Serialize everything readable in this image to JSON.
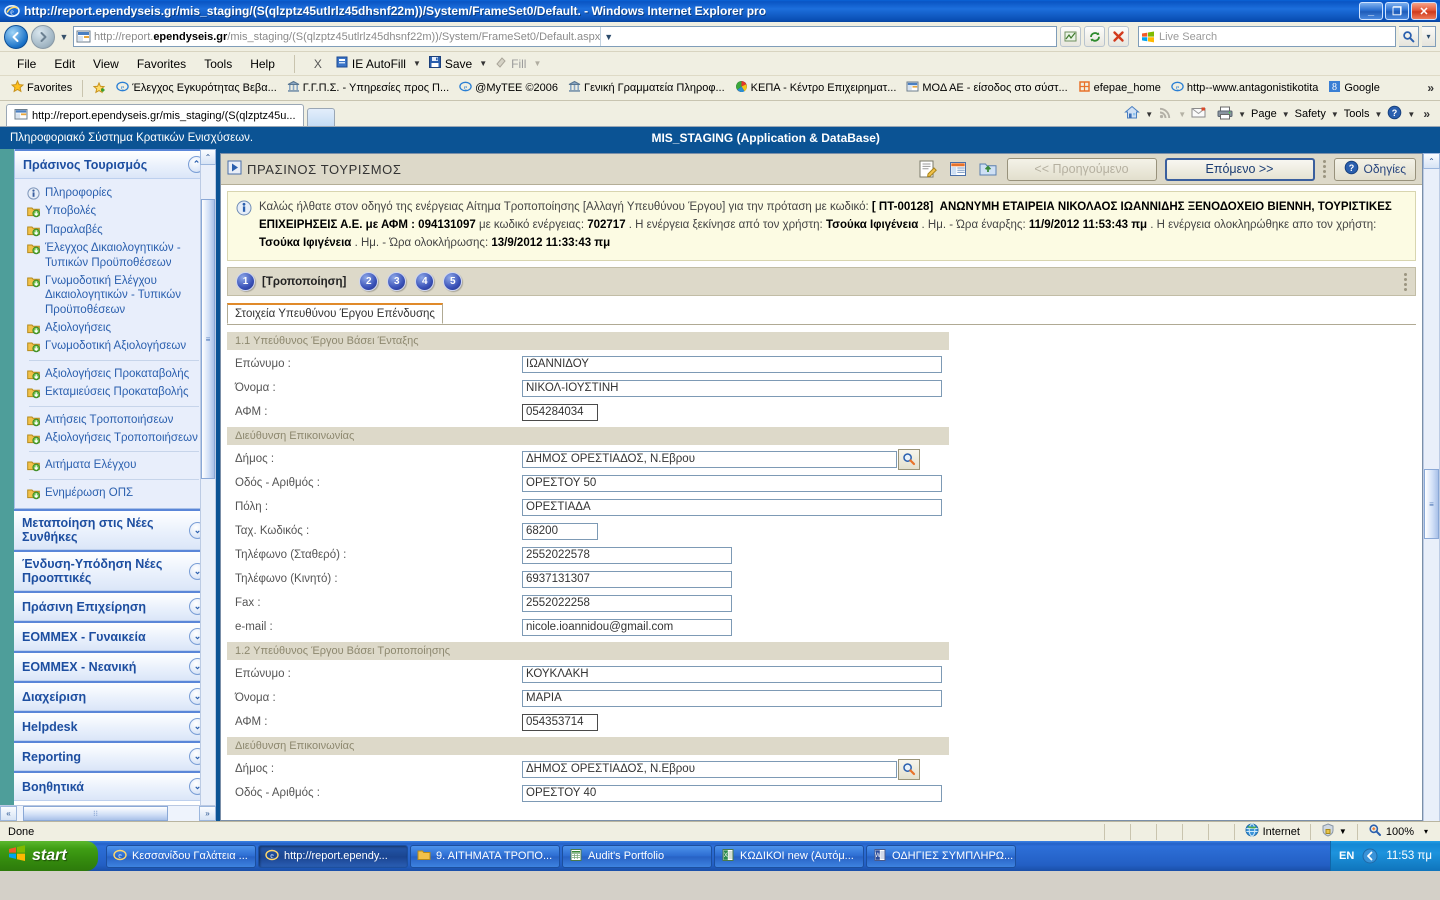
{
  "window": {
    "title": "http://report.ependyseis.gr/mis_staging/(S(qlzptz45utlrlz45dhsnf22m))/System/FrameSet0/Default. - Windows Internet Explorer pro",
    "minimize_label": "_",
    "maximize_label": "❐",
    "close_label": "✕"
  },
  "address_bar": {
    "url_prefix": "http://report.",
    "url_domain": "ependyseis.gr",
    "url_suffix": "/mis_staging/(S(qlzptz45utlrlz45dhsnf22m))/System/FrameSet0/Default.aspx",
    "back_label": "◄",
    "forward_label": "►",
    "refresh_label": "↻",
    "stop_label": "✕",
    "compat_label": "⛰"
  },
  "search": {
    "placeholder": "Live Search",
    "go_label": "⌕",
    "drop_label": "▾"
  },
  "menu": {
    "items": [
      "File",
      "Edit",
      "View",
      "Favorites",
      "Tools",
      "Help"
    ],
    "autofill_close": "X",
    "autofill_label": "IE AutoFill",
    "save_label": "Save",
    "fill_label": "Fill"
  },
  "favorites_bar": {
    "favorites_label": "Favorites",
    "items": [
      {
        "label": "Έλεγχος Εγκυρότητας Βεβα...",
        "icon": "ie-icon"
      },
      {
        "label": "Γ.Γ.Π.Σ. - Υπηρεσίες προς Π...",
        "icon": "bank-icon"
      },
      {
        "label": "@MyTEE ©2006",
        "icon": "ie-icon"
      },
      {
        "label": "Γενική Γραμματεία Πληροφ...",
        "icon": "bank-icon"
      },
      {
        "label": "ΚΕΠΑ - Κέντρο Επιχειρηματ...",
        "icon": "color-wheel-icon"
      },
      {
        "label": "ΜΟΔ ΑΕ - είσοδος στο σύστ...",
        "icon": "page-icon"
      },
      {
        "label": "efepae_home",
        "icon": "orange-icon"
      },
      {
        "label": "http--www.antagonistikotita",
        "icon": "ie-icon"
      },
      {
        "label": "Google",
        "icon": "google-icon"
      }
    ],
    "overflow_label": "»"
  },
  "tabs": {
    "active_tab": "http://report.ependyseis.gr/mis_staging/(S(qlzptz45u...",
    "new_tab_label": ""
  },
  "command_bar": {
    "items": [
      {
        "label": "",
        "icon": "home-icon",
        "caret": true
      },
      {
        "label": "",
        "icon": "feeds-icon",
        "caret": true,
        "disabled": true
      },
      {
        "label": "",
        "icon": "mail-icon",
        "caret": false
      },
      {
        "label": "",
        "icon": "print-icon",
        "caret": true
      },
      {
        "label": "Page",
        "icon": "",
        "caret": true
      },
      {
        "label": "Safety",
        "icon": "",
        "caret": true
      },
      {
        "label": "Tools",
        "icon": "",
        "caret": true
      },
      {
        "label": "",
        "icon": "help-icon",
        "caret": true
      }
    ],
    "overflow_label": "»"
  },
  "app": {
    "header_left": "Πληροφοριακό Σύστημα Κρατικών Ενισχύσεων.",
    "header_right": "MIS_STAGING (Application & DataBase)"
  },
  "sidebar": {
    "groups": [
      {
        "title": "Πράσινος Τουρισμός",
        "expanded": true,
        "chevron": "⌃",
        "items": [
          {
            "label": "Πληροφορίες",
            "icon": "info-icon",
            "divider_after": false
          },
          {
            "label": "Υποβολές",
            "icon": "folder-arrow-icon",
            "divider_after": false
          },
          {
            "label": "Παραλαβές",
            "icon": "folder-arrow-icon",
            "divider_after": false
          },
          {
            "label": "Έλεγχος Δικαιολογητικών - Τυπικών Προϋποθέσεων",
            "icon": "folder-arrow-icon",
            "divider_after": false
          },
          {
            "label": "Γνωμοδοτική Ελέγχου Δικαιολογητικών - Τυπικών Προϋποθέσεων",
            "icon": "folder-arrow-icon",
            "divider_after": false
          },
          {
            "label": "Αξιολογήσεις",
            "icon": "folder-arrow-icon",
            "divider_after": false
          },
          {
            "label": "Γνωμοδοτική Αξιολογήσεων",
            "icon": "folder-arrow-icon",
            "divider_after": true
          },
          {
            "label": "Αξιολογήσεις Προκαταβολής",
            "icon": "folder-arrow-icon",
            "divider_after": false
          },
          {
            "label": "Εκταμιεύσεις Προκαταβολής",
            "icon": "folder-arrow-icon",
            "divider_after": true
          },
          {
            "label": "Αιτήσεις Τροποποιήσεων",
            "icon": "folder-arrow-icon",
            "divider_after": false
          },
          {
            "label": "Αξιολογήσεις Τροποποιήσεων",
            "icon": "folder-arrow-icon",
            "divider_after": true
          },
          {
            "label": "Αιτήματα Ελέγχου",
            "icon": "folder-arrow-icon",
            "divider_after": true
          },
          {
            "label": "Ενημέρωση ΟΠΣ",
            "icon": "folder-arrow-icon",
            "divider_after": false
          }
        ]
      },
      {
        "title": "Μεταποίηση στις Νέες Συνθήκες",
        "expanded": false,
        "chevron": "⌄",
        "items": []
      },
      {
        "title": "Ένδυση-Υπόδηση Νέες Προοπτικές",
        "expanded": false,
        "chevron": "⌄",
        "items": []
      },
      {
        "title": "Πράσινη Επιχείρηση",
        "expanded": false,
        "chevron": "⌄",
        "items": []
      },
      {
        "title": "ΕΟΜΜΕΧ - Γυναικεία",
        "expanded": false,
        "chevron": "⌄",
        "items": []
      },
      {
        "title": "ΕΟΜΜΕΧ - Νεανική",
        "expanded": false,
        "chevron": "⌄",
        "items": []
      },
      {
        "title": "Διαχείριση",
        "expanded": false,
        "chevron": "⌄",
        "items": []
      },
      {
        "title": "Helpdesk",
        "expanded": false,
        "chevron": "⌄",
        "items": []
      },
      {
        "title": "Reporting",
        "expanded": false,
        "chevron": "⌄",
        "items": []
      },
      {
        "title": "Βοηθητικά",
        "expanded": false,
        "chevron": "⌄",
        "items": []
      }
    ],
    "scroll_up": "⌃",
    "scroll_down": "⌄",
    "hscroll_left": "«",
    "hscroll_right": "»"
  },
  "content": {
    "title": "ΠΡΑΣΙΝΟΣ ΤΟΥΡΙΣΜΟΣ",
    "title_icon": "play-box-icon",
    "toolbar": {
      "edit_icon": "note-edit-icon",
      "grid_icon": "table-icon",
      "export_icon": "folder-export-icon",
      "prev_label": "<< Προηγούμενο",
      "next_label": "Επόμενο >>",
      "help_label": "Οδηγίες"
    },
    "info": {
      "line1_a": "Καλώς ήλθατε στον οδηγό της ενέργειας Αίτημα Τροποποίησης [Αλλαγή Υπευθύνου Έργου] για την πρόταση με κωδικό:",
      "code": "[ ΠΤ-00128]",
      "company": "ΑΝΩΝΥΜΗ ΕΤΑΙΡΕΙΑ ΝΙΚΟΛΑΟΣ ΙΩΑΝΝΙΔΗΣ ΞΕΝΟΔΟΧΕΙΟ ΒΙΕΝΝΗ, ΤΟΥΡΙΣΤΙΚΕΣ ΕΠΙΧΕΙΡΗΣΕΙΣ Α.Ε. με ΑΦΜ : 094131097",
      "line2_a": "με κωδικό ενέργειας:",
      "action_code": "702717",
      "line2_b": ". Η ενέργεια ξεκίνησε από τον χρήστη:",
      "start_user": "Τσούκα Ιφιγένεια",
      "line2_c": ". Ημ. - Ώρα έναρξης:",
      "start_datetime": "11/9/2012 11:53:43 πμ",
      "line2_d": ". Η ενέργεια ολοκληρώθηκε απο τον χρήστη:",
      "end_user": "Τσούκα Ιφιγένεια",
      "line3_a": ". Ημ. - Ώρα ολοκλήρωσης:",
      "end_datetime": "13/9/2012 11:33:43 πμ"
    },
    "steps": [
      {
        "num": "1",
        "label": "[Τροποποίηση]"
      },
      {
        "num": "2",
        "label": ""
      },
      {
        "num": "3",
        "label": ""
      },
      {
        "num": "4",
        "label": ""
      },
      {
        "num": "5",
        "label": ""
      }
    ],
    "form_tab": "Στοιχεία Υπευθύνου Έργου Επένδυσης",
    "sections": [
      {
        "title": "1.1 Υπεύθυνος Έργου Βάσει Ένταξης",
        "fields": [
          {
            "label": "Επώνυμο :",
            "value": "ΙΩΑΝΝΙΔΟΥ",
            "size": "full",
            "lookup": false,
            "dark": false
          },
          {
            "label": "Όνομα :",
            "value": "ΝΙΚΟΛ-ΙΟΥΣΤΙΝΗ",
            "size": "full",
            "lookup": false,
            "dark": false
          },
          {
            "label": "ΑΦΜ :",
            "value": "054284034",
            "size": "small",
            "lookup": false,
            "dark": true
          }
        ]
      },
      {
        "title": "Διεύθυνση Επικοινωνίας",
        "fields": [
          {
            "label": "Δήμος :",
            "value": "ΔΗΜΟΣ ΟΡΕΣΤΙΑΔΟΣ, Ν.Εβρου",
            "size": "lookup",
            "lookup": true,
            "dark": false
          },
          {
            "label": "Οδός - Αριθμός :",
            "value": "ΟΡΕΣΤΟΥ 50",
            "size": "full",
            "lookup": false,
            "dark": false
          },
          {
            "label": "Πόλη :",
            "value": "ΟΡΕΣΤΙΑΔΑ",
            "size": "full",
            "lookup": false,
            "dark": false
          },
          {
            "label": "Ταχ. Κωδικός :",
            "value": "68200",
            "size": "small",
            "lookup": false,
            "dark": false
          },
          {
            "label": "Τηλέφωνο (Σταθερό) :",
            "value": "2552022578",
            "size": "med",
            "lookup": false,
            "dark": false
          },
          {
            "label": "Τηλέφωνο (Κινητό) :",
            "value": "6937131307",
            "size": "med",
            "lookup": false,
            "dark": false
          },
          {
            "label": "Fax :",
            "value": "2552022258",
            "size": "med",
            "lookup": false,
            "dark": false
          },
          {
            "label": "e-mail :",
            "value": "nicole.ioannidou@gmail.com",
            "size": "med",
            "lookup": false,
            "dark": false
          }
        ]
      },
      {
        "title": "1.2 Υπεύθυνος Έργου Βάσει Τροποποίησης",
        "fields": [
          {
            "label": "Επώνυμο :",
            "value": "ΚΟΥΚΛΑΚΗ",
            "size": "full",
            "lookup": false,
            "dark": false
          },
          {
            "label": "Όνομα :",
            "value": "ΜΑΡΙΑ",
            "size": "full",
            "lookup": false,
            "dark": false
          },
          {
            "label": "ΑΦΜ :",
            "value": "054353714",
            "size": "small",
            "lookup": false,
            "dark": true
          }
        ]
      },
      {
        "title": "Διεύθυνση Επικοινωνίας",
        "fields": [
          {
            "label": "Δήμος :",
            "value": "ΔΗΜΟΣ ΟΡΕΣΤΙΑΔΟΣ, Ν.Εβρου",
            "size": "lookup",
            "lookup": true,
            "dark": false
          },
          {
            "label": "Οδός - Αριθμός :",
            "value": "ΟΡΕΣΤΟΥ 40",
            "size": "full",
            "lookup": false,
            "dark": false
          }
        ]
      }
    ]
  },
  "statusbar": {
    "text": "Done",
    "zone": "Internet",
    "zoom": "100%",
    "protect_icon": "shield-icon",
    "zoom_icon": "magnifier-icon",
    "zoom_caret": "▾"
  },
  "taskbar": {
    "start_label": "start",
    "tasks": [
      {
        "label": "Κεσσανίδου Γαλάτεια ...",
        "icon": "ie-icon",
        "active": false
      },
      {
        "label": "http://report.ependy...",
        "icon": "ie-icon",
        "active": true
      },
      {
        "label": "9. ΑΙΤΗΜΑΤΑ ΤΡΟΠΟ...",
        "icon": "folder-icon",
        "active": false
      },
      {
        "label": "Audit's Portfolio",
        "icon": "excel-icon",
        "active": false
      },
      {
        "label": "ΚΩΔΙΚΟΙ new (Αυτόμ...",
        "icon": "excel-icon",
        "active": false
      },
      {
        "label": "ΟΔΗΓΙΕΣ ΣΥΜΠΛΗΡΩ...",
        "icon": "word-icon",
        "active": false
      }
    ],
    "language": "EN",
    "clock": "11:53 πμ",
    "tray_icon": "arrow-left-icon"
  }
}
